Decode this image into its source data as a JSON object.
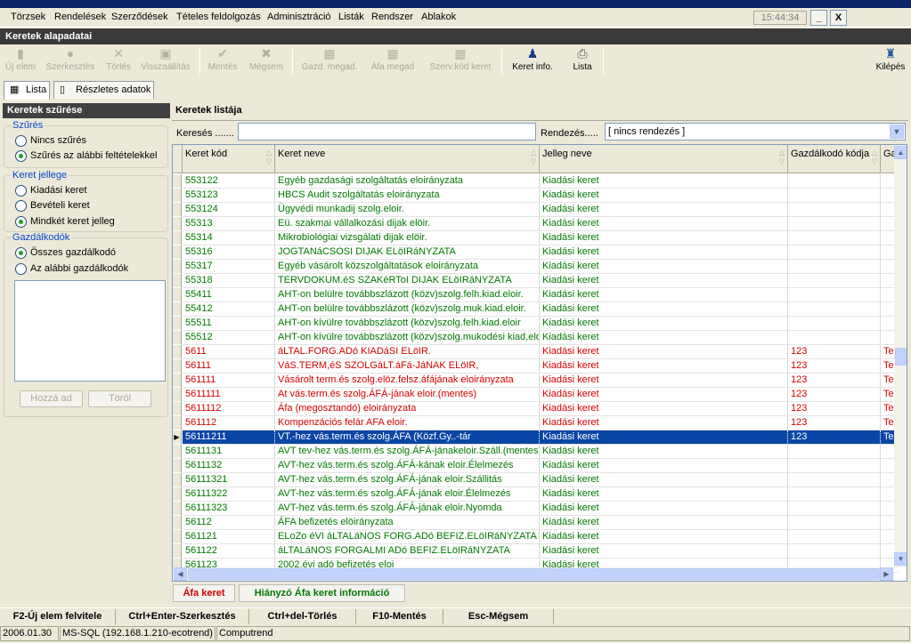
{
  "menu": [
    "Törzsek",
    "Rendelések",
    "Szerződések",
    "Tételes feldolgozás",
    "Adminisztráció",
    "Listák",
    "Rendszer",
    "Ablakok"
  ],
  "clock": "15:44:34",
  "window_buttons": {
    "minimize": "_",
    "close": "X"
  },
  "form_title": "Keretek alapadatai",
  "toolbar": [
    {
      "label": "Új elem",
      "icon": "new-icon",
      "enabled": false
    },
    {
      "label": "Szerkesztés",
      "icon": "edit-icon",
      "enabled": false
    },
    {
      "label": "Törlés",
      "icon": "delete-icon",
      "enabled": false
    },
    {
      "label": "Visszaállítás",
      "icon": "restore-icon",
      "enabled": false
    },
    {
      "label": "Mentés",
      "icon": "check-icon",
      "enabled": false
    },
    {
      "label": "Mégsem",
      "icon": "cancel-icon",
      "enabled": false
    },
    {
      "label": "Gazd. megad.",
      "icon": "grid-icon",
      "enabled": false
    },
    {
      "label": "Áfa megad",
      "icon": "grid-icon",
      "enabled": false
    },
    {
      "label": "Szerv.kód keret",
      "icon": "grid-icon",
      "enabled": false
    },
    {
      "label": "Keret info.",
      "icon": "person-icon",
      "enabled": true
    },
    {
      "label": "Lista",
      "icon": "printer-icon",
      "enabled": true
    }
  ],
  "exit_label": "Kilépés",
  "tabs": [
    "Lista",
    "Részletes adatok"
  ],
  "filter": {
    "title": "Keretek szűrése",
    "group1": {
      "title": "Szűrés",
      "options": [
        "Nincs szűrés",
        "Szűrés az alábbi feltételekkel"
      ],
      "selected": 1
    },
    "group2": {
      "title": "Keret jellege",
      "options": [
        "Kiadási keret",
        "Bevételi keret",
        "Mindkét keret jelleg"
      ],
      "selected": 2
    },
    "group3": {
      "title": "Gazdálkodók",
      "options": [
        "Összes gazdálkodó",
        "Az alábbi gazdálkodók"
      ],
      "selected": 0
    },
    "add_label": "Hozzá ad",
    "remove_label": "Töröl"
  },
  "list": {
    "title": "Keretek listája",
    "search_label": "Keresés .......",
    "search_value": "",
    "sort_label": "Rendezés.....",
    "sort_value": "[ nincs rendezés ]",
    "columns": [
      "Keret kód",
      "Keret neve",
      "Jelleg neve",
      "Gazdálkodó kódja",
      "Ga"
    ],
    "rows": [
      {
        "kod": "553122",
        "nev": "Egyéb gazdasági szolgáltatás eloirányzata",
        "jelleg": "Kiadási keret",
        "gazd": "",
        "extra": "",
        "color": "green"
      },
      {
        "kod": "553123",
        "nev": "HBCS Audit szolgáltatás eloirányzata",
        "jelleg": "Kiadási keret",
        "gazd": "",
        "extra": "",
        "color": "green"
      },
      {
        "kod": "553124",
        "nev": "Ügyvédi munkadij szolg.eloir.",
        "jelleg": "Kiadási keret",
        "gazd": "",
        "extra": "",
        "color": "green"
      },
      {
        "kod": "55313",
        "nev": "Eü. szakmai vállalkozási dijak elöir.",
        "jelleg": "Kiadási keret",
        "gazd": "",
        "extra": "",
        "color": "green"
      },
      {
        "kod": "55314",
        "nev": "Mikrobiológiai vizsgálati dijak elöir.",
        "jelleg": "Kiadási keret",
        "gazd": "",
        "extra": "",
        "color": "green"
      },
      {
        "kod": "55316",
        "nev": "JOGTANáCSOSI DIJAK ELöIRáNYZATA",
        "jelleg": "Kiadási keret",
        "gazd": "",
        "extra": "",
        "color": "green"
      },
      {
        "kod": "55317",
        "nev": "Egyéb vásárolt közszolgáltatások eloirányzata",
        "jelleg": "Kiadási keret",
        "gazd": "",
        "extra": "",
        "color": "green"
      },
      {
        "kod": "55318",
        "nev": "TERVDOKUM.éS SZAKéRToI DIJAK ELöIRáNYZATA",
        "jelleg": "Kiadási keret",
        "gazd": "",
        "extra": "",
        "color": "green"
      },
      {
        "kod": "55411",
        "nev": "AHT-on belülre továbbszlázott (közv)szolg.felh.kiad.eloir.",
        "jelleg": "Kiadási keret",
        "gazd": "",
        "extra": "",
        "color": "green"
      },
      {
        "kod": "55412",
        "nev": "AHT-on belülre továbbszlázott (közv)szolg.muk.kiad.eloir.",
        "jelleg": "Kiadási keret",
        "gazd": "",
        "extra": "",
        "color": "green"
      },
      {
        "kod": "55511",
        "nev": "AHT-on kívülre továbbszlázott (közv)szolg.felh.kiad.eloir",
        "jelleg": "Kiadási keret",
        "gazd": "",
        "extra": "",
        "color": "green"
      },
      {
        "kod": "55512",
        "nev": "AHT-on kívülre továbbszlázott (közv)szolg.mukodési kiad,eloi",
        "jelleg": "Kiadási keret",
        "gazd": "",
        "extra": "",
        "color": "green"
      },
      {
        "kod": "5611",
        "nev": "áLTAL.FORG.ADó KIADáSI ELöIR.",
        "jelleg": "Kiadási keret",
        "gazd": "123",
        "extra": "Te",
        "color": "red"
      },
      {
        "kod": "56111",
        "nev": "VáS.TERM,éS SZOLGáLT.áFá-JáNAK ELöIR,",
        "jelleg": "Kiadási keret",
        "gazd": "123",
        "extra": "Te",
        "color": "red"
      },
      {
        "kod": "561111",
        "nev": "Vásárolt term.és szolg.elöz.felsz.áfájának eloirányzata",
        "jelleg": "Kiadási keret",
        "gazd": "123",
        "extra": "Te",
        "color": "red"
      },
      {
        "kod": "5611111",
        "nev": "At vás.term.és szolg.ÁFÁ-jának eloir.(mentes)",
        "jelleg": "Kiadási keret",
        "gazd": "123",
        "extra": "Te",
        "color": "red"
      },
      {
        "kod": "5611112",
        "nev": "Áfa (megosztandó) eloirányzata",
        "jelleg": "Kiadási keret",
        "gazd": "123",
        "extra": "Te",
        "color": "red"
      },
      {
        "kod": "561112",
        "nev": "Kompenzációs felár AFA eloir.",
        "jelleg": "Kiadási keret",
        "gazd": "123",
        "extra": "Te",
        "color": "red"
      },
      {
        "kod": "56111211",
        "nev": "VT.-hez vás.term.és szolg.ÁFA (Közf.Gy..-tár",
        "jelleg": "Kiadási keret",
        "gazd": "123",
        "extra": "Te",
        "color": "red",
        "selected": true
      },
      {
        "kod": "5611131",
        "nev": "AVT tev-hez vás.term.és szolg.ÁFÁ-jánakeloir.Száll.(mentes)",
        "jelleg": "Kiadási keret",
        "gazd": "",
        "extra": "",
        "color": "green"
      },
      {
        "kod": "5611132",
        "nev": "AVT-hez vás.term.és szolg.ÁFÁ-kának eloir.Élelmezés",
        "jelleg": "Kiadási keret",
        "gazd": "",
        "extra": "",
        "color": "green"
      },
      {
        "kod": "56111321",
        "nev": "AVT-hez vás.term.és szolg.ÁFÁ-jának eloir.Szállitás",
        "jelleg": "Kiadási keret",
        "gazd": "",
        "extra": "",
        "color": "green"
      },
      {
        "kod": "56111322",
        "nev": "AVT-hez vás.term.és szolg.ÁFÁ-jának eloir.Élelmezés",
        "jelleg": "Kiadási keret",
        "gazd": "",
        "extra": "",
        "color": "green"
      },
      {
        "kod": "56111323",
        "nev": "AVT-hez vás.term.és szolg.ÁFÁ-jának eloir.Nyomda",
        "jelleg": "Kiadási keret",
        "gazd": "",
        "extra": "",
        "color": "green"
      },
      {
        "kod": "56112",
        "nev": "ÁFA befizetés elöirányzata",
        "jelleg": "Kiadási keret",
        "gazd": "",
        "extra": "",
        "color": "green"
      },
      {
        "kod": "561121",
        "nev": "ELoZo éVI áLTALáNOS FORG.ADó BEFIZ.ELöIRáNYZATA",
        "jelleg": "Kiadási keret",
        "gazd": "",
        "extra": "",
        "color": "green"
      },
      {
        "kod": "561122",
        "nev": "áLTALáNOS FORGALMI ADó BEFIZ.ELöIRáNYZATA",
        "jelleg": "Kiadási keret",
        "gazd": "",
        "extra": "",
        "color": "green"
      },
      {
        "kod": "561123",
        "nev": "2002.évi adó befizetés eloi",
        "jelleg": "Kiadási keret",
        "gazd": "",
        "extra": "",
        "color": "green"
      }
    ]
  },
  "legend": {
    "afa": "Áfa keret",
    "missing": "Hiányzó Áfa keret információ"
  },
  "fkeys": [
    "F2-Új elem felvitele",
    "Ctrl+Enter-Szerkesztés",
    "Ctrl+del-Törlés",
    "F10-Mentés",
    "Esc-Mégsem"
  ],
  "status": [
    "2006.01.30",
    "MS-SQL (192.168.1.210-ecotrend)",
    "Computrend"
  ],
  "colors": {
    "green": "#007a00",
    "red": "#d40000",
    "selected": "#0a46a6",
    "header": "#3a3a3a"
  }
}
